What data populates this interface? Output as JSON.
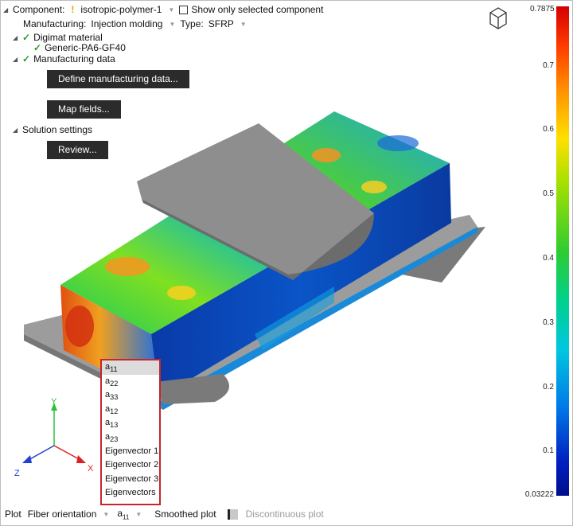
{
  "panel": {
    "component_label": "Component:",
    "component_value": "isotropic-polymer-1",
    "show_only_label": "Show only selected component",
    "manufacturing_label": "Manufacturing:",
    "manufacturing_value": "Injection molding",
    "type_label": "Type:",
    "type_value": "SFRP",
    "tree": {
      "material_label": "Digimat material",
      "material_item": "Generic-PA6-GF40",
      "manufacturing_data_label": "Manufacturing data",
      "define_button": "Define manufacturing data...",
      "map_button": "Map fields...",
      "solution_label": "Solution settings",
      "review_button": "Review..."
    }
  },
  "axes": {
    "x": "X",
    "y": "Y",
    "z": "Z"
  },
  "color_scale": {
    "max_label": "0.7875",
    "min_label": "0.03222",
    "ticks": [
      "0.7",
      "0.6",
      "0.5",
      "0.4",
      "0.3",
      "0.2",
      "0.1"
    ]
  },
  "dropdown_menu": {
    "items": [
      {
        "base": "a",
        "sub": "11"
      },
      {
        "base": "a",
        "sub": "22"
      },
      {
        "base": "a",
        "sub": "33"
      },
      {
        "base": "a",
        "sub": "12"
      },
      {
        "base": "a",
        "sub": "13"
      },
      {
        "base": "a",
        "sub": "23"
      },
      {
        "base": "Eigenvector 1",
        "sub": ""
      },
      {
        "base": "Eigenvector 2",
        "sub": ""
      },
      {
        "base": "Eigenvector 3",
        "sub": ""
      },
      {
        "base": "Eigenvectors",
        "sub": ""
      }
    ]
  },
  "bottom_bar": {
    "plot_label": "Plot",
    "plot_value": "Fiber orientation",
    "component_base": "a",
    "component_sub": "11",
    "smoothed_label": "Smoothed plot",
    "discontinuous_label": "Discontinuous plot"
  },
  "colors": {
    "highlight_border": "#c8242c",
    "button_bg": "#2b2b2b",
    "check_green": "#2a9a2a"
  }
}
